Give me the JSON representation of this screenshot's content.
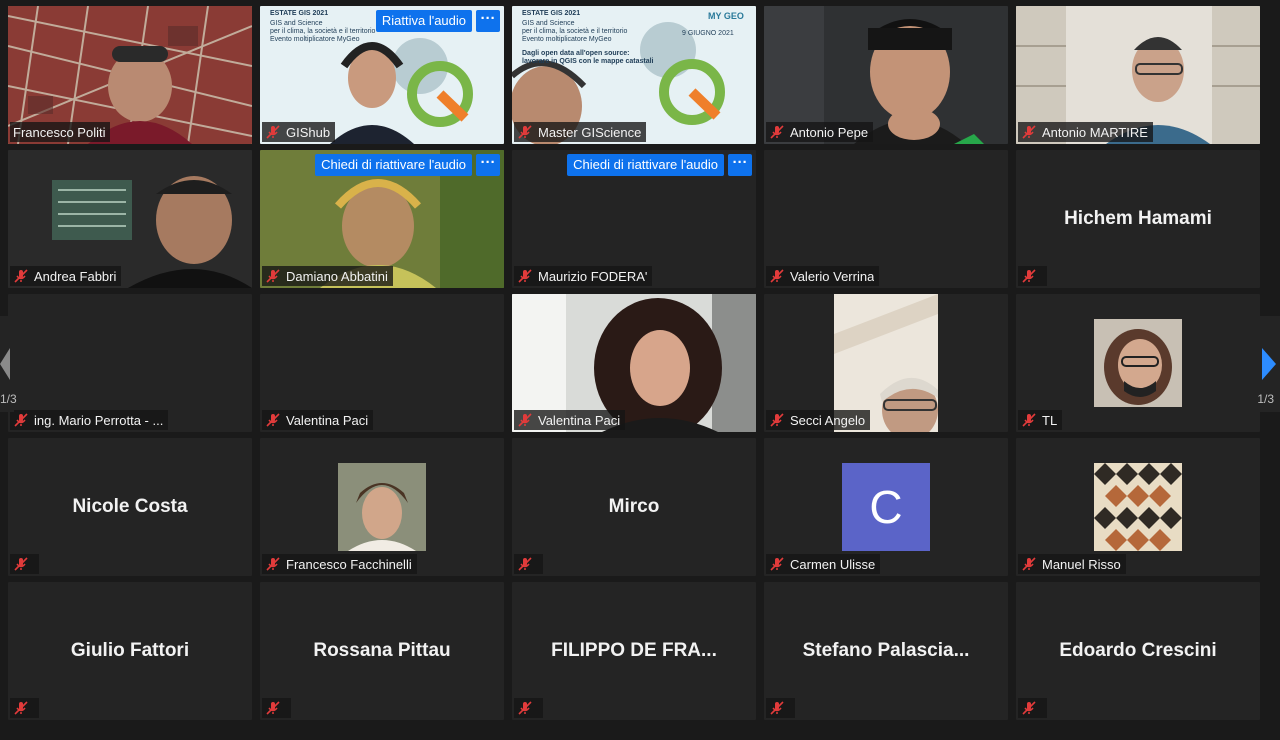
{
  "colors": {
    "accent": "#0e72ed",
    "active_speaker": "#e6e07a",
    "tile_bg": "#242424",
    "muted_red": "#e23b3b"
  },
  "tiles": [
    {
      "name": "Francesco Politi",
      "center": "",
      "kind": "video-map"
    },
    {
      "name": "GIShub",
      "center": "",
      "kind": "video-slide",
      "audio_button": "Riattiva l'audio",
      "more": "···"
    },
    {
      "name": "Master GIScience",
      "center": "",
      "kind": "video-slide"
    },
    {
      "name": "Antonio Pepe",
      "center": "",
      "kind": "video"
    },
    {
      "name": "Antonio MARTIRE",
      "center": "",
      "kind": "video"
    },
    {
      "name": "Andrea Fabbri",
      "center": "",
      "kind": "video"
    },
    {
      "name": "Damiano Abbatini",
      "center": "",
      "kind": "video",
      "audio_button": "Chiedi di riattivare l'audio",
      "more": "···"
    },
    {
      "name": "Maurizio FODERA'",
      "center": "",
      "kind": "empty",
      "audio_button": "Chiedi di riattivare l'audio",
      "more": "···"
    },
    {
      "name": "Valerio Verrina",
      "center": "",
      "kind": "empty"
    },
    {
      "name": "",
      "center": "Hichem Hamami",
      "kind": "name"
    },
    {
      "name": "ing. Mario Perrotta - ...",
      "center": "",
      "kind": "empty"
    },
    {
      "name": "Valentina Paci",
      "center": "",
      "kind": "empty"
    },
    {
      "name": "Valentina Paci",
      "center": "",
      "kind": "video"
    },
    {
      "name": "Secci Angelo",
      "center": "",
      "kind": "portrait"
    },
    {
      "name": "TL",
      "center": "",
      "kind": "thumb"
    },
    {
      "name": "",
      "center": "Nicole Costa",
      "kind": "name"
    },
    {
      "name": "Francesco Facchinelli",
      "center": "",
      "kind": "thumb"
    },
    {
      "name": "",
      "center": "Mirco",
      "kind": "name"
    },
    {
      "name": "Carmen Ulisse",
      "center": "",
      "kind": "letter",
      "letter": "C"
    },
    {
      "name": "Manuel Risso",
      "center": "",
      "kind": "thumb-pattern"
    },
    {
      "name": "",
      "center": "Giulio Fattori",
      "kind": "name"
    },
    {
      "name": "",
      "center": "Rossana Pittau",
      "kind": "name"
    },
    {
      "name": "",
      "center": "FILIPPO DE FRA...",
      "kind": "name"
    },
    {
      "name": "",
      "center": "Stefano  Palascia...",
      "kind": "name"
    },
    {
      "name": "",
      "center": "Edoardo Crescini",
      "kind": "name"
    }
  ],
  "slide": {
    "title": "ESTATE GIS 2021",
    "lines": [
      "GIS and Science",
      "per il clima, la società e il territorio",
      "Evento moltiplicatore MyGeo"
    ],
    "logo": "MY GEO",
    "date": "9 GIUGNO 2021",
    "body": [
      "Dagli open data all'open source:",
      "lavorare in QGIS con le mappe catastali"
    ]
  },
  "pager": {
    "left": "1/3",
    "right": "1/3"
  }
}
